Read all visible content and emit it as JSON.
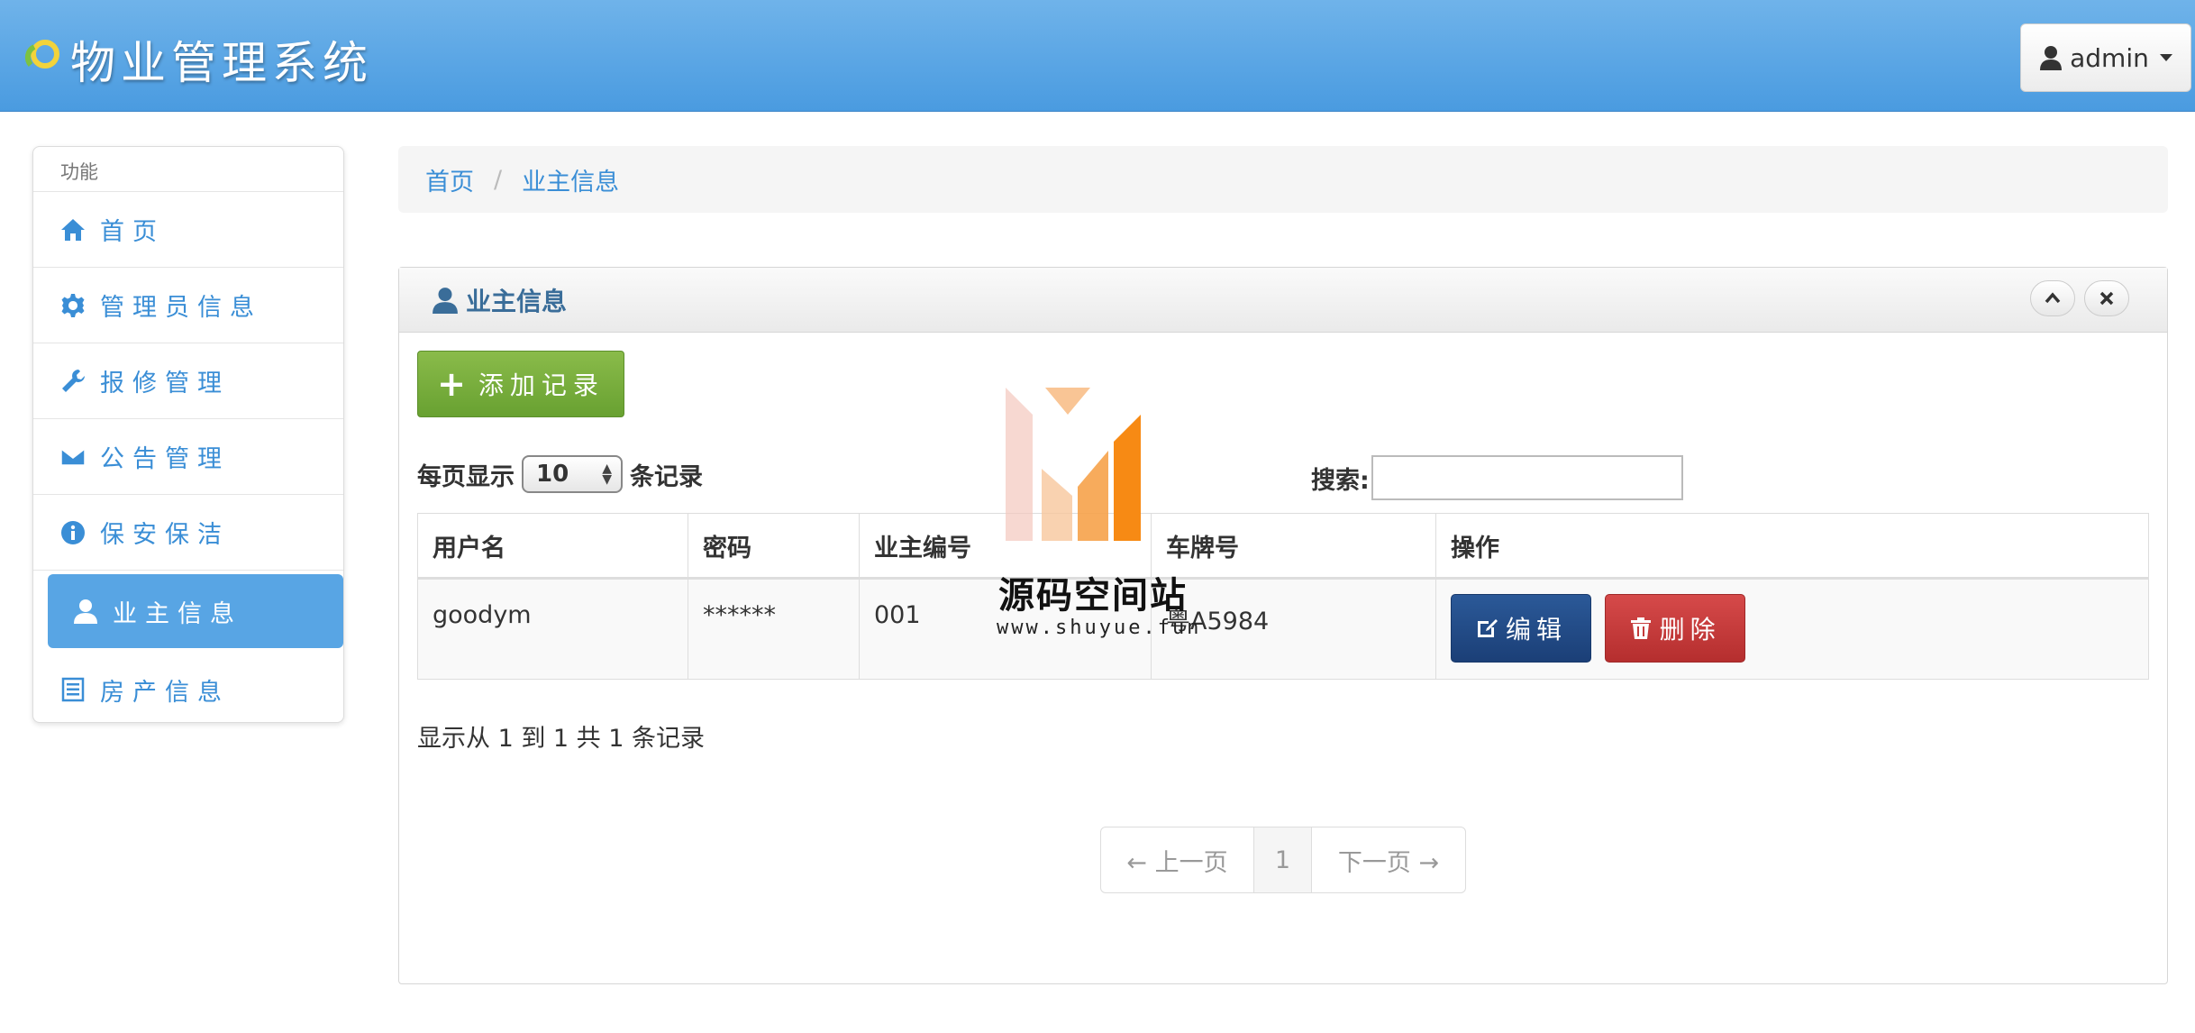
{
  "header": {
    "title": "物业管理系统",
    "user_label": "admin"
  },
  "sidebar": {
    "heading": "功能",
    "items": [
      {
        "label": "首页",
        "icon": "home-icon"
      },
      {
        "label": "管理员信息",
        "icon": "gear-icon"
      },
      {
        "label": "报修管理",
        "icon": "wrench-icon"
      },
      {
        "label": "公告管理",
        "icon": "envelope-icon"
      },
      {
        "label": "保安保洁",
        "icon": "info-icon"
      },
      {
        "label": "业主信息",
        "icon": "user-icon",
        "active": true
      },
      {
        "label": "房产信息",
        "icon": "list-icon"
      }
    ]
  },
  "breadcrumb": {
    "home": "首页",
    "separator": "/",
    "current": "业主信息"
  },
  "panel": {
    "title": "业主信息",
    "add_label": "添加记录",
    "length_prefix": "每页显示",
    "length_value": "10",
    "length_suffix": "条记录",
    "search_label": "搜索:",
    "search_value": "",
    "columns": [
      "用户名",
      "密码",
      "业主编号",
      "车牌号",
      "操作"
    ],
    "rows": [
      {
        "username": "goodym",
        "password": "******",
        "owner_id": "001",
        "plate": "粤A5984"
      }
    ],
    "edit_label": "编辑",
    "delete_label": "删除",
    "info": "显示从 1 到 1 共 1 条记录",
    "pagination": {
      "prev": "← 上一页",
      "page": "1",
      "next": "下一页 →"
    }
  },
  "watermark": {
    "text": "源码空间站",
    "url": "www.shuyue.fun"
  },
  "colors": {
    "navbar": "#4a9be0",
    "link": "#3a8ed6",
    "active_item": "#58a5e4",
    "add_button": "#68a131",
    "edit_button": "#1b3f77",
    "delete_button": "#b52e2e"
  }
}
